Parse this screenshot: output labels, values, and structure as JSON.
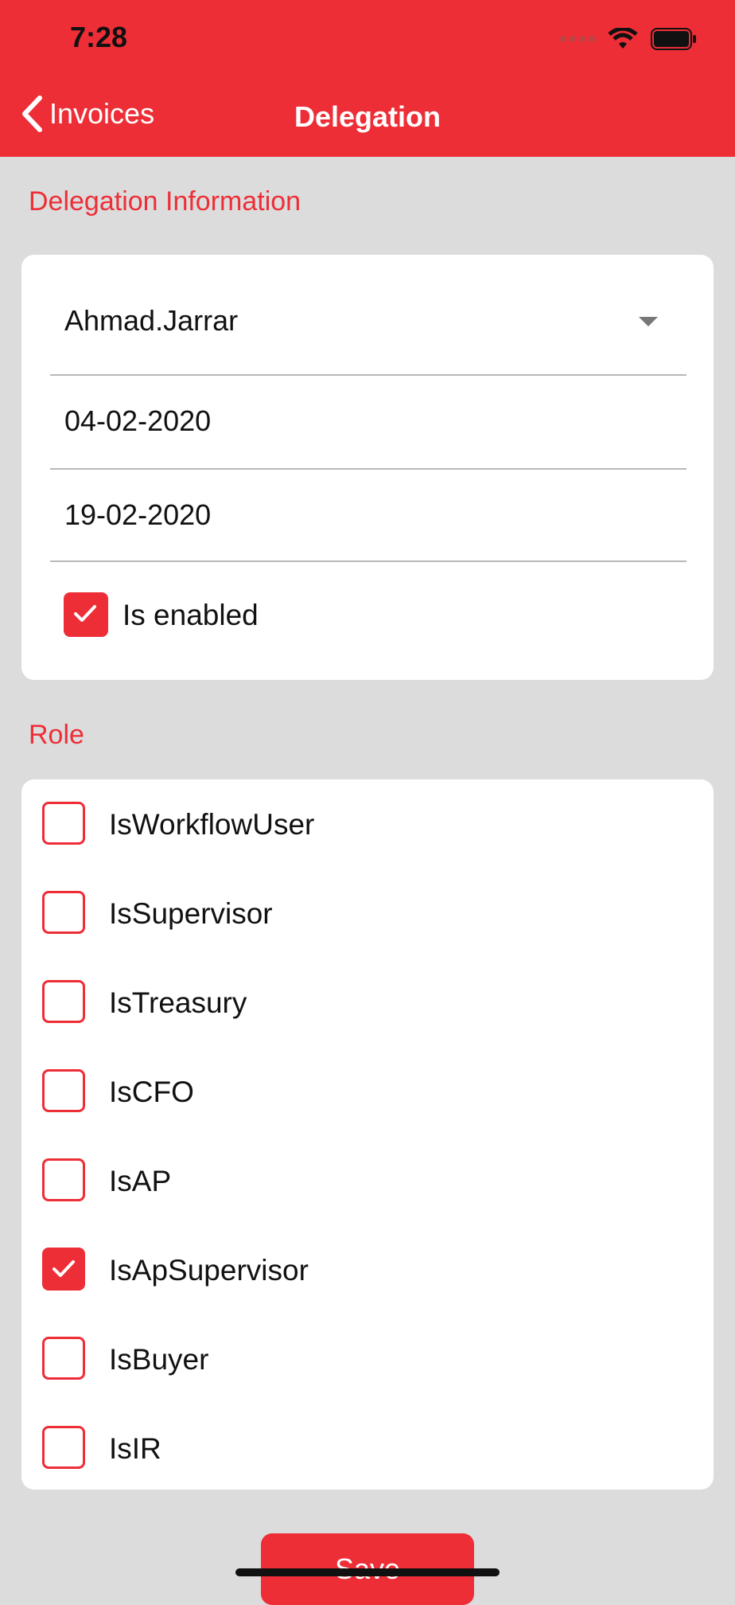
{
  "status_bar": {
    "time": "7:28"
  },
  "nav": {
    "back_label": "Invoices",
    "title": "Delegation"
  },
  "delegation": {
    "section_title": "Delegation Information",
    "user": "Ahmad.Jarrar",
    "start_date": "04-02-2020",
    "end_date": "19-02-2020",
    "enabled_label": "Is enabled",
    "enabled": true
  },
  "role": {
    "section_title": "Role",
    "items": [
      {
        "label": "IsWorkflowUser",
        "checked": false
      },
      {
        "label": "IsSupervisor",
        "checked": false
      },
      {
        "label": "IsTreasury",
        "checked": false
      },
      {
        "label": "IsCFO",
        "checked": false
      },
      {
        "label": "IsAP",
        "checked": false
      },
      {
        "label": "IsApSupervisor",
        "checked": true
      },
      {
        "label": "IsBuyer",
        "checked": false
      },
      {
        "label": "IsIR",
        "checked": false
      }
    ]
  },
  "actions": {
    "save_label": "Save"
  },
  "colors": {
    "accent": "#ee2e37",
    "background": "#dcdcdc"
  }
}
